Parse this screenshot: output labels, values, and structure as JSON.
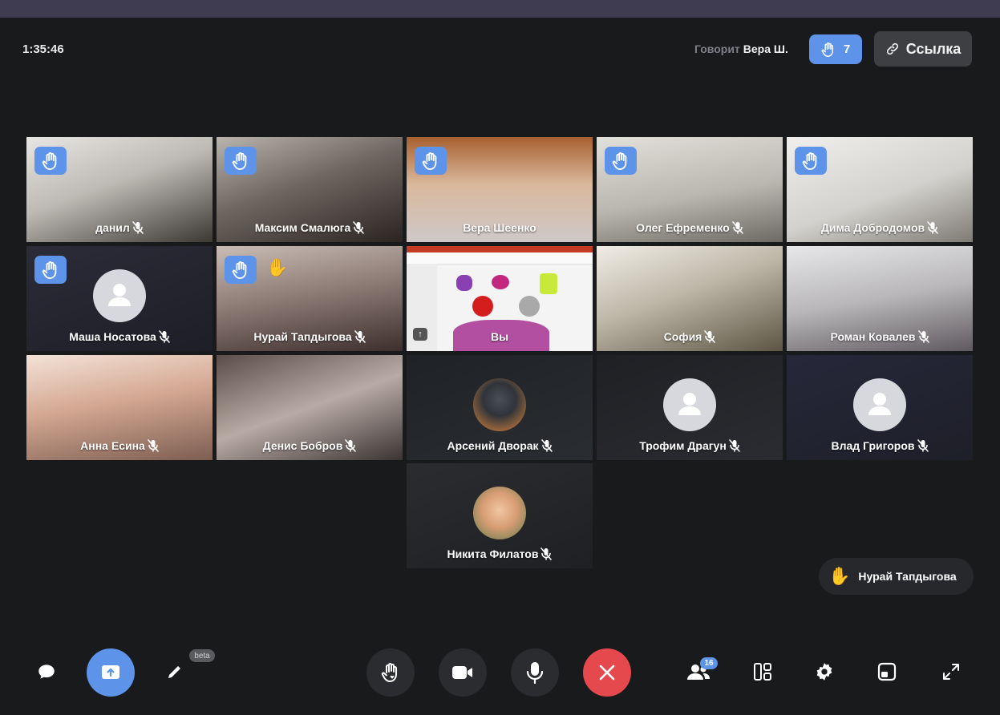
{
  "header": {
    "timer": "1:35:46",
    "speaking_label": "Говорит",
    "speaking_name": "Вера Ш.",
    "raised_hands_count": "7",
    "link_label": "Ссылка"
  },
  "colors": {
    "accent": "#5d93e8",
    "background": "#191a1c",
    "end_call": "#e5484d"
  },
  "participants": [
    {
      "name": "данил",
      "hand_raised": true,
      "muted": true,
      "video": "camera"
    },
    {
      "name": "Максим Смалюга",
      "hand_raised": true,
      "muted": true,
      "video": "camera"
    },
    {
      "name": "Вера Шеенко",
      "hand_raised": true,
      "muted": false,
      "video": "camera"
    },
    {
      "name": "Олег Ефременко",
      "hand_raised": true,
      "muted": true,
      "video": "camera"
    },
    {
      "name": "Дима Добродомов",
      "hand_raised": true,
      "muted": true,
      "video": "camera"
    },
    {
      "name": "Маша Носатова",
      "hand_raised": true,
      "muted": true,
      "video": "avatar-default"
    },
    {
      "name": "Нурай Тапдыгова",
      "hand_raised": true,
      "muted": true,
      "video": "camera"
    },
    {
      "name": "Вы",
      "hand_raised": false,
      "muted": false,
      "video": "screen-share"
    },
    {
      "name": "София",
      "hand_raised": false,
      "muted": true,
      "video": "camera"
    },
    {
      "name": "Роман Ковалев",
      "hand_raised": false,
      "muted": true,
      "video": "camera"
    },
    {
      "name": "Анна Есина",
      "hand_raised": false,
      "muted": true,
      "video": "camera"
    },
    {
      "name": "Денис Бобров",
      "hand_raised": false,
      "muted": true,
      "video": "camera"
    },
    {
      "name": "Арсений Дворак",
      "hand_raised": false,
      "muted": true,
      "video": "avatar-photo"
    },
    {
      "name": "Трофим Драгун",
      "hand_raised": false,
      "muted": true,
      "video": "avatar-default"
    },
    {
      "name": "Влад Григоров",
      "hand_raised": false,
      "muted": true,
      "video": "avatar-default"
    },
    {
      "name": "Никита Филатов",
      "hand_raised": false,
      "muted": true,
      "video": "avatar-photo"
    }
  ],
  "toast": {
    "icon": "raised-hand-emoji",
    "name": "Нурай Тапдыгова"
  },
  "toolbar": {
    "left": [
      {
        "icon": "chat-icon"
      },
      {
        "icon": "screen-share-icon",
        "active": true
      },
      {
        "icon": "pencil-icon",
        "badge": "beta"
      }
    ],
    "center": [
      {
        "icon": "raise-hand-icon"
      },
      {
        "icon": "camera-icon"
      },
      {
        "icon": "microphone-icon"
      },
      {
        "icon": "end-call-icon"
      }
    ],
    "right": [
      {
        "icon": "participants-icon",
        "badge": "16"
      },
      {
        "icon": "layout-icon"
      },
      {
        "icon": "settings-icon"
      },
      {
        "icon": "picture-in-picture-icon"
      },
      {
        "icon": "fullscreen-icon"
      }
    ]
  }
}
